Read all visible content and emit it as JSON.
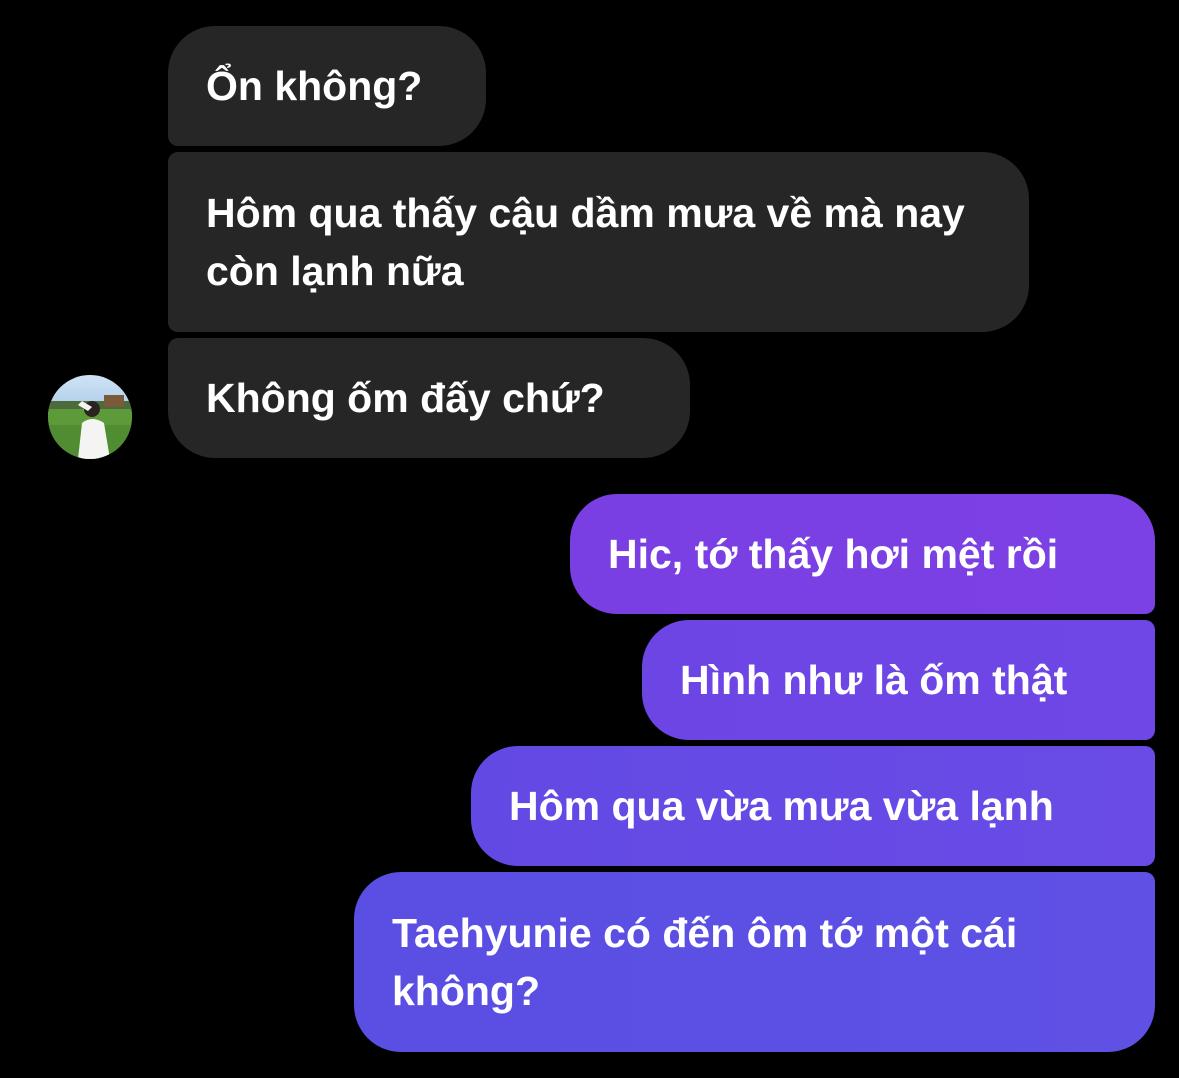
{
  "conversation": {
    "incoming": [
      {
        "text": "Ổn không?"
      },
      {
        "text": "Hôm qua thấy cậu dầm mưa về mà nay còn lạnh nữa"
      },
      {
        "text": "Không ốm đấy chứ?"
      }
    ],
    "outgoing": [
      {
        "text": "Hic, tớ thấy hơi mệt rồi"
      },
      {
        "text": "Hình như là ốm thật"
      },
      {
        "text": "Hôm qua vừa mưa vừa lạnh"
      },
      {
        "text": "Taehyunie có đến ôm tớ một cái không?"
      }
    ]
  },
  "colors": {
    "background": "#000000",
    "incoming_bubble": "#262626",
    "outgoing_bubble_top": "#7c41e4",
    "outgoing_bubble_bottom": "#5e51e4",
    "text": "#ffffff"
  }
}
